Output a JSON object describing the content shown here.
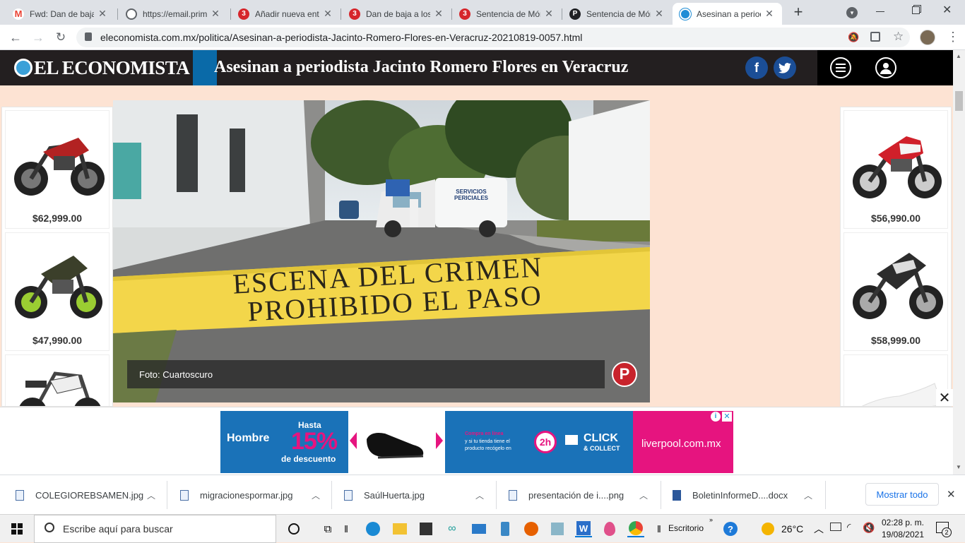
{
  "browser": {
    "tabs": [
      {
        "title": "Fwd: Dan de baja",
        "icon": "gmail-icon",
        "color": "#ea4335",
        "letter": "M"
      },
      {
        "title": "https://email.prim",
        "icon": "globe-icon",
        "color": "#5f6368",
        "letter": ""
      },
      {
        "title": "Añadir nueva ent",
        "icon": "proceso-icon",
        "color": "#d6262b",
        "letter": ""
      },
      {
        "title": "Dan de baja a los",
        "icon": "proceso-icon",
        "color": "#d6262b",
        "letter": ""
      },
      {
        "title": "Sentencia de Món",
        "icon": "proceso-icon",
        "color": "#d6262b",
        "letter": ""
      },
      {
        "title": "Sentencia de Món",
        "icon": "pbar-icon",
        "color": "#202124",
        "letter": "P"
      },
      {
        "title": "Asesinan a period",
        "icon": "eleconomista-icon",
        "color": "#1f8dd6",
        "letter": ""
      }
    ],
    "new_tab": "+",
    "url": "eleconomista.com.mx/politica/Asesinan-a-periodista-Jacinto-Romero-Flores-en-Veracruz-20210819-0057.html"
  },
  "site": {
    "logo": "EL ECONOMISTA",
    "headline": "Asesinan a periodista Jacinto Romero Flores en Veracruz",
    "facebook": "f",
    "twitter": "t"
  },
  "ads_left": [
    {
      "price": "$62,999.00",
      "bike_color": "#b22222"
    },
    {
      "price": "$47,990.00",
      "bike_color": "#9acd32"
    },
    {
      "price": "",
      "bike_color": "#dddddd"
    }
  ],
  "ads_right": [
    {
      "price": "$56,990.00",
      "bike_color": "#d0202a"
    },
    {
      "price": "$58,999.00",
      "bike_color": "#333333"
    },
    {
      "price": "",
      "bike_color": "#f4f4f4"
    }
  ],
  "hero": {
    "tape_line1": "ESCENA DEL CRIMEN",
    "tape_line2": "PROHIBIDO EL PASO",
    "van_text1": "SERVICIOS",
    "van_text2": "PERICIALES",
    "caption": "Foto: Cuartoscuro",
    "pin": "P"
  },
  "banner": {
    "segment1": "Hombre",
    "hasta": "Hasta",
    "percent": "15%",
    "descuento": "de descuento",
    "promo_line1": "Compra en línea",
    "promo_line2": "y si tu tienda tiene el",
    "promo_line3": "producto recógelo en",
    "twoh": "2h",
    "click": "CLICK",
    "collect": "& COLLECT",
    "brand": "liverpool.com.mx"
  },
  "downloads": {
    "items": [
      "COLEGIOREBSAMEN.jpg",
      "migracionespormar.jpg",
      "SaúlHuerta.jpg",
      "presentación de i....png",
      "BoletinInformeD....docx"
    ],
    "show_all": "Mostrar todo"
  },
  "taskbar": {
    "search_placeholder": "Escribe aquí para buscar",
    "desktop_label": "Escritorio",
    "temperature": "26°C",
    "time": "02:28 p. m.",
    "date": "19/08/2021",
    "notifications": "2"
  }
}
